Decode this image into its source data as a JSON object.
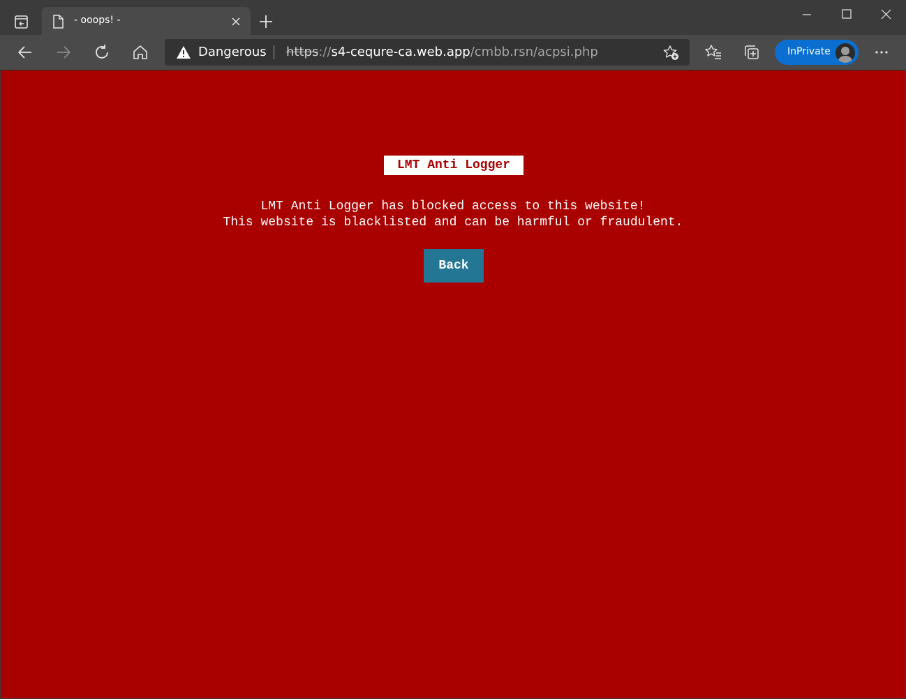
{
  "browser": {
    "tab_title": "- ooops! -",
    "address_bar": {
      "security_label": "Dangerous",
      "scheme": "https",
      "scheme_sep": "://",
      "host": "s4-cequre-ca.web.app",
      "path": "/cmbb.rsn/acpsi.php"
    },
    "profile_label": "InPrivate",
    "icons": [
      "tab-actions-icon",
      "page-icon",
      "close-icon",
      "plus-icon",
      "minimize-icon",
      "maximize-icon",
      "close-window-icon",
      "back-arrow-icon",
      "forward-arrow-icon",
      "refresh-icon",
      "home-icon",
      "warning-icon",
      "add-favorite-icon",
      "favorites-icon",
      "collections-icon",
      "avatar",
      "more-icon"
    ]
  },
  "page": {
    "badge": "LMT Anti Logger",
    "message_line1": "LMT Anti Logger has blocked access to this website!",
    "message_line2": "This website is blacklisted and can be harmful or fraudulent.",
    "back_label": "Back"
  },
  "colors": {
    "page_background": "#a90000",
    "button_background": "#237795",
    "inprivate_accent": "#0a6fd0"
  }
}
